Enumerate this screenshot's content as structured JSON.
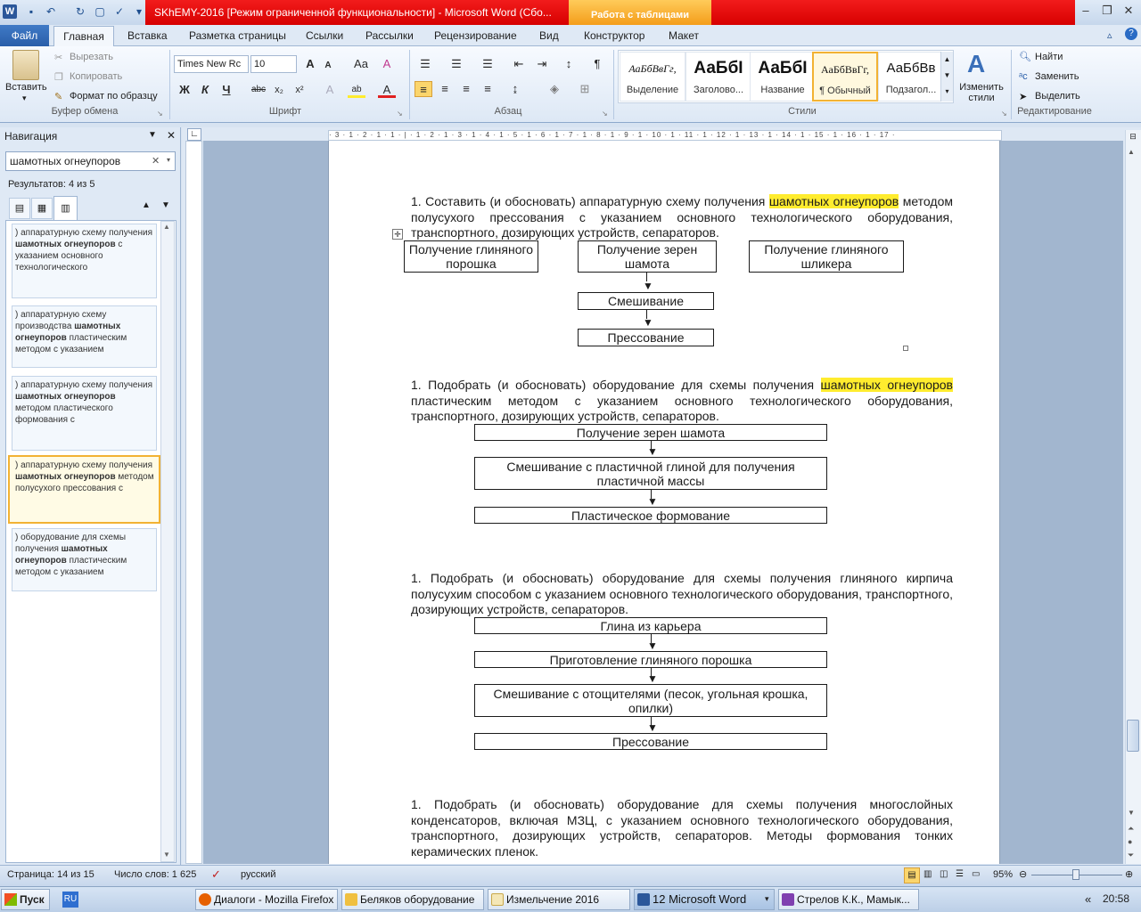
{
  "window": {
    "title": "SKhEMY-2016 [Режим ограниченной функциональности] - Microsoft Word (Сбо...",
    "context_tab": "Работа с таблицами"
  },
  "tabs": {
    "file": "Файл",
    "home": "Главная",
    "insert": "Вставка",
    "layout": "Разметка страницы",
    "refs": "Ссылки",
    "mail": "Рассылки",
    "review": "Рецензирование",
    "view": "Вид",
    "design": "Конструктор",
    "tlayout": "Макет"
  },
  "clipboard": {
    "paste": "Вставить",
    "cut": "Вырезать",
    "copy": "Копировать",
    "format_painter": "Формат по образцу",
    "group": "Буфер обмена"
  },
  "font": {
    "name": "Times New Rc",
    "size": "10",
    "group": "Шрифт",
    "grow": "A",
    "shrink": "A",
    "case": "Aa",
    "clear": "A",
    "bold": "Ж",
    "italic": "К",
    "underline": "Ч",
    "strike": "abc",
    "sub": "x₂",
    "sup": "x²",
    "effects": "A",
    "highlight": "ab",
    "color": "A"
  },
  "paragraph": {
    "group": "Абзац",
    "marks": "¶"
  },
  "styles": {
    "group": "Стили",
    "change": "Изменить стили",
    "items": [
      {
        "preview": "АаБбВвГг,",
        "label": "Выделение"
      },
      {
        "preview": "АаБбI",
        "label": "Заголово..."
      },
      {
        "preview": "АаБбI",
        "label": "Название"
      },
      {
        "preview": "АаБбВвГг,",
        "label": "¶ Обычный"
      },
      {
        "preview": "АаБбВв",
        "label": "Подзагол..."
      }
    ]
  },
  "editing": {
    "group": "Редактирование",
    "find": "Найти",
    "replace": "Заменить",
    "select": "Выделить"
  },
  "nav": {
    "title": "Навигация",
    "search": "шамотных огнеупоров",
    "results": "Результатов: 4 из 5",
    "items": [
      {
        "pre": ") аппаратурную схему получения ",
        "b": "шамотных огнеупоров",
        "post": " с указанием основного технологического"
      },
      {
        "pre": ") аппаратурную схему производства ",
        "b": "шамотных огнеупоров",
        "post": " пластическим методом с указанием"
      },
      {
        "pre": ") аппаратурную схему получения ",
        "b": "шамотных огнеупоров",
        "post": " методом пластического формования с"
      },
      {
        "pre": ") аппаратурную схему получения ",
        "b": "шамотных огнеупоров",
        "post": " методом полусухого прессования с"
      },
      {
        "pre": ") оборудование для схемы получения ",
        "b": "шамотных огнеупоров",
        "post": " пластическим методом с указанием"
      }
    ]
  },
  "ruler": {
    "text": "· 3 · 1 · 2 · 1 · 1 · | · 1 · 2 · 1 · 3 · 1 · 4 · 1 · 5 · 1 · 6 · 1 · 7 · 1 · 8 · 1 · 9 · 1 · 10 · 1 · 11 · 1 · 12 · 1 · 13 · 1 · 14 · 1 · 15 · 1 · 16 · 1 · 17 ·"
  },
  "doc": {
    "p1": {
      "a": "1. Составить (и обосновать) аппаратурную схему получения ",
      "h": "шамотных огнеупоров",
      "b": " методом полусухого прессования с указанием основного технологического оборудования, транспортного, дозирующих устройств, сепараторов."
    },
    "s1": {
      "b1": "Получение глиняного порошка",
      "b2": "Получение зерен шамота",
      "b3": "Получение глиняного шликера",
      "b4": "Смешивание",
      "b5": "Прессование"
    },
    "p2": {
      "a": "1. Подобрать (и обосновать) оборудование для схемы получения ",
      "h": "шамотных огнеупоров",
      "b": " пластическим методом с указанием основного технологического оборудования, транспортного, дозирующих устройств, сепараторов."
    },
    "s2": {
      "b1": "Получение зерен шамота",
      "b2": "Смешивание с пластичной глиной для получения пластичной массы",
      "b3": "Пластическое формование"
    },
    "p3": "1. Подобрать (и обосновать) оборудование для схемы получения глиняного кирпича полусухим способом с указанием основного технологического оборудования, транспортного, дозирующих устройств, сепараторов.",
    "s3": {
      "b1": "Глина из карьера",
      "b2": "Приготовление глиняного порошка",
      "b3": "Смешивание с отощителями (песок, угольная крошка, опилки)",
      "b4": "Прессование"
    },
    "p4": "1. Подобрать (и обосновать) оборудование для схемы получения многослойных конденсаторов, включая МЗЦ, с указанием основного технологического оборудования, транспортного, дозирующих устройств, сепараторов. Методы формования тонких керамических пленок."
  },
  "status": {
    "page": "Страница: 14 из 15",
    "words": "Число слов: 1 625",
    "lang": "русский",
    "zoom": "95%"
  },
  "taskbar": {
    "start": "Пуск",
    "lang": "RU",
    "items": [
      "Диалоги - Mozilla Firefox",
      "Беляков оборудование",
      "Измельчение 2016",
      "12 Microsoft Word",
      "Стрелов К.К., Мамык..."
    ],
    "clock": "20:58"
  }
}
